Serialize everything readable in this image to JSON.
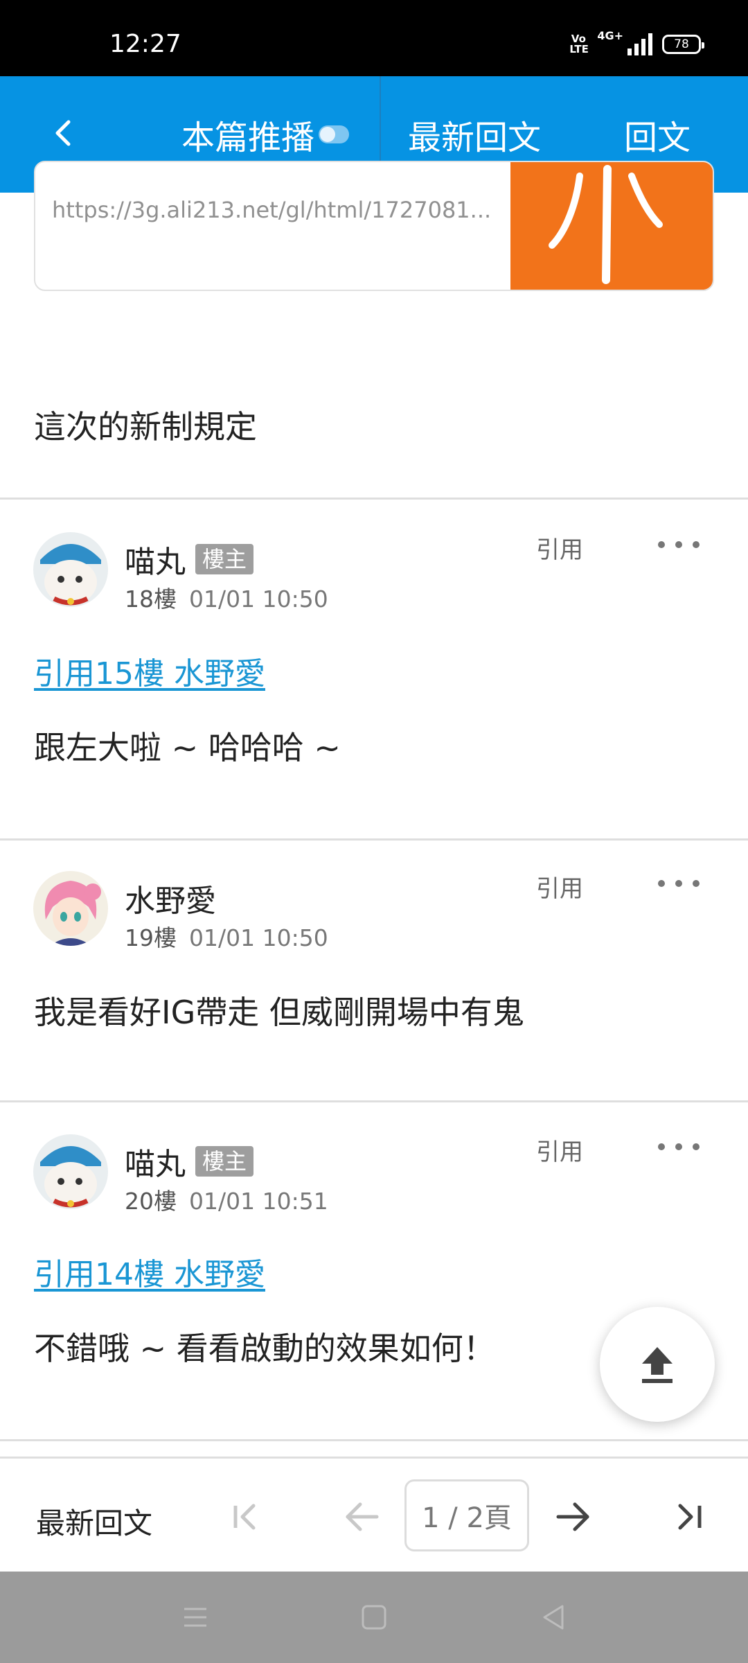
{
  "status_bar": {
    "time": "12:27",
    "volte": "Vo\nLTE",
    "network": "4G+",
    "battery": "78"
  },
  "nav": {
    "push_label": "本篇推播",
    "latest_label": "最新回文",
    "reply_label": "回文"
  },
  "link_card": {
    "url": "https://3g.ali213.net/gl/html/1727081..."
  },
  "intro_text": "這次的新制規定",
  "posts": [
    {
      "username": "喵丸",
      "badge": "樓主",
      "floor": "18樓",
      "time": "01/01 10:50",
      "quote_label": "引用",
      "quote_link": "引用15樓 水野愛",
      "text": "跟左大啦 ~ 哈哈哈 ~"
    },
    {
      "username": "水野愛",
      "badge": "",
      "floor": "19樓",
      "time": "01/01 10:50",
      "quote_label": "引用",
      "quote_link": "",
      "text": "我是看好IG帶走 但威剛開場中有鬼"
    },
    {
      "username": "喵丸",
      "badge": "樓主",
      "floor": "20樓",
      "time": "01/01 10:51",
      "quote_label": "引用",
      "quote_link": "引用14樓 水野愛",
      "text": "不錯哦 ~ 看看啟動的效果如何！"
    }
  ],
  "pager": {
    "latest_label": "最新回文",
    "page_indicator": "1 / 2頁"
  },
  "colors": {
    "nav_bg": "#0693e3",
    "link_blue": "#1a96d4",
    "badge_gray": "#9e9e9e"
  },
  "icons": {
    "back": "back-arrow-icon",
    "scroll_top": "upload-arrow-icon",
    "first_page": "first-page-icon",
    "prev_page": "left-arrow-icon",
    "next_page": "right-arrow-icon",
    "last_page": "last-page-icon"
  }
}
